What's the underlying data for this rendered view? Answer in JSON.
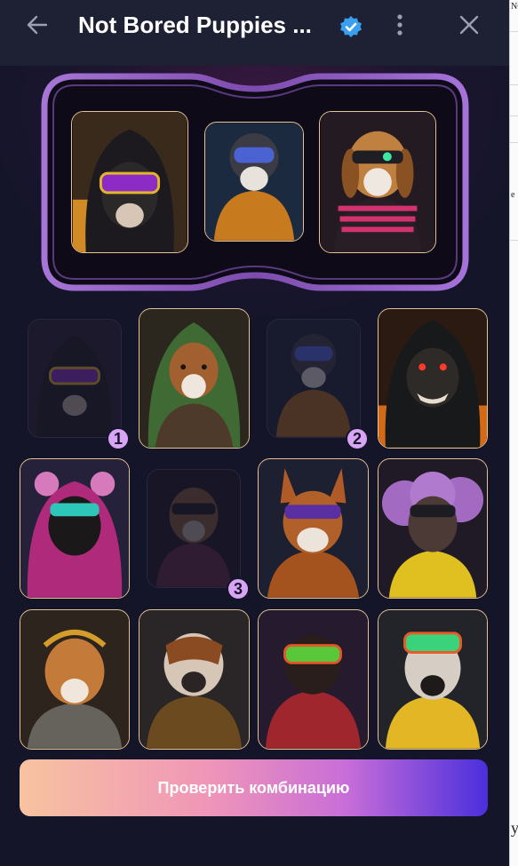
{
  "header": {
    "title": "Not Bored Puppies ...",
    "back_icon": "arrow-left-icon",
    "verified_icon": "verified-badge-icon",
    "menu_icon": "more-vertical-icon",
    "close_icon": "close-icon"
  },
  "selection": {
    "slots": [
      {
        "dog": "hooded-black-dog-purple-goggles"
      },
      {
        "dog": "pilot-dog-orange-suit-helmet"
      },
      {
        "dog": "beagle-neon-goggles-pink-sweater"
      }
    ]
  },
  "grid": {
    "cards": [
      {
        "dog": "hooded-black-dog-purple-goggles",
        "selected": true,
        "badge": "1"
      },
      {
        "dog": "beagle-green-hood-armor",
        "selected": false,
        "badge": ""
      },
      {
        "dog": "pilot-dog-orange-suit-helmet",
        "selected": true,
        "badge": "2"
      },
      {
        "dog": "angry-dog-dark-hood-red-eyes",
        "selected": false,
        "badge": ""
      },
      {
        "dog": "black-dog-pink-bear-hoodie",
        "selected": false,
        "badge": ""
      },
      {
        "dog": "beagle-neon-goggles-pink-sweater",
        "selected": true,
        "badge": "3"
      },
      {
        "dog": "boxer-purple-sunglasses",
        "selected": false,
        "badge": ""
      },
      {
        "dog": "purple-poodle-yellow-jacket",
        "selected": false,
        "badge": ""
      },
      {
        "dog": "tan-dog-headphones-armor",
        "selected": false,
        "badge": ""
      },
      {
        "dog": "pitbull-brown-jacket",
        "selected": false,
        "badge": ""
      },
      {
        "dog": "dog-rainbow-goggles-red-hoodie",
        "selected": false,
        "badge": ""
      },
      {
        "dog": "dog-rainbow-goggles-yellow-jacket",
        "selected": false,
        "badge": ""
      }
    ]
  },
  "action": {
    "check_label": "Проверить комбинацию"
  },
  "background_fragments": [
    "NC",
    "e",
    "y"
  ]
}
